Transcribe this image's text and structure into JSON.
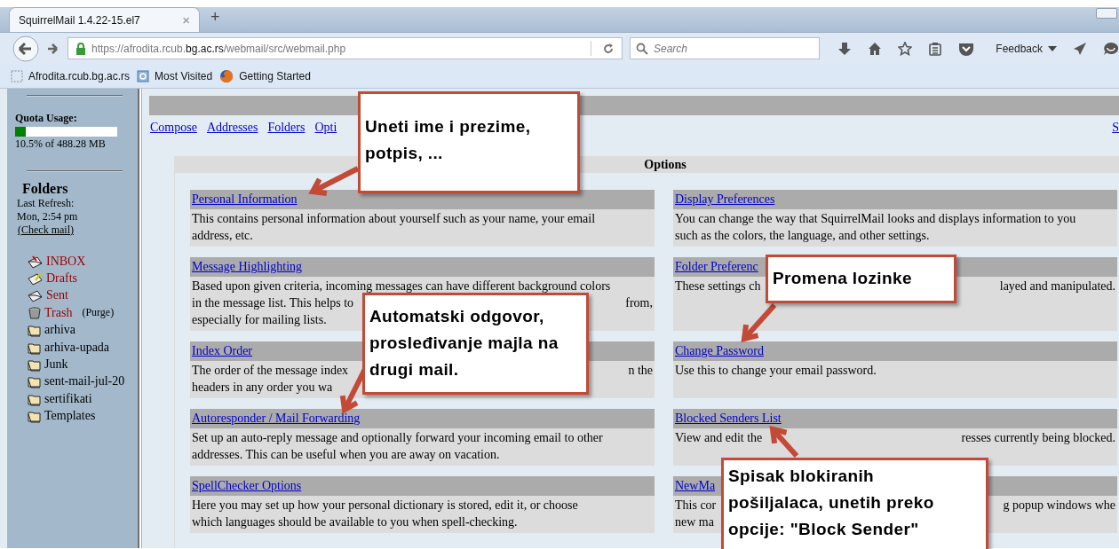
{
  "browser": {
    "tab_title": "SquirrelMail 1.4.22-15.el7",
    "tab_close": "×",
    "new_tab": "+",
    "url": {
      "start": "https://afrodita.rcub.",
      "domain": "bg.ac.rs",
      "path": "/webmail/src/webmail.php"
    },
    "search_placeholder": "Search",
    "feedback": "Feedback",
    "bookmarks": [
      "Afrodita.rcub.bg.ac.rs",
      "Most Visited",
      "Getting Started"
    ]
  },
  "sidebar": {
    "quota": {
      "label": "Quota Usage:",
      "level": 0.105,
      "reading": "10.5% of 488.28 MB"
    },
    "folders_title": "Folders",
    "last_refresh_label": "Last Refresh:",
    "last_refresh": "Mon, 2:54 pm",
    "check_mail": "(Check mail)",
    "folders": [
      {
        "name": "INBOX",
        "kind": "inbox"
      },
      {
        "name": "Drafts",
        "kind": "drafts"
      },
      {
        "name": "Sent",
        "kind": "sent"
      },
      {
        "name": "Trash",
        "kind": "trash",
        "action": "(Purge)"
      },
      {
        "name": "arhiva",
        "kind": "folder"
      },
      {
        "name": "arhiva-upada",
        "kind": "folder"
      },
      {
        "name": "Junk",
        "kind": "folder"
      },
      {
        "name": "sent-mail-jul-20",
        "kind": "folder"
      },
      {
        "name": "sertifikati",
        "kind": "folder"
      },
      {
        "name": "Templates",
        "kind": "folder"
      }
    ]
  },
  "nav_links": [
    "Compose",
    "Addresses",
    "Folders",
    "Opti"
  ],
  "nav_right": "S",
  "options": {
    "title": "Options",
    "left": [
      {
        "title": "Personal Information",
        "lines": [
          [
            "This contains personal information about yourself such as your name, your email"
          ],
          [
            "address, etc."
          ]
        ]
      },
      {
        "title": "Message Highlighting",
        "lines": [
          [
            "Based upon given criteria, incoming messages can have different background colors"
          ],
          [
            "in the message list. This helps to",
            "from,"
          ],
          [
            "especially for mailing lists."
          ]
        ]
      },
      {
        "title": "Index Order",
        "lines": [
          [
            "The order of the message index",
            "n the"
          ],
          [
            "headers in any order you wa"
          ]
        ]
      },
      {
        "title": "Autoresponder / Mail Forwarding",
        "lines": [
          [
            "Set up an auto-reply message and optionally forward your incoming email to other"
          ],
          [
            "addresses. This can be useful when you are away on vacation."
          ]
        ]
      },
      {
        "title": "SpellChecker Options",
        "lines": [
          [
            "Here you may set up how your personal dictionary is stored, edit it, or choose"
          ],
          [
            "which languages should be available to you when spell-checking."
          ]
        ]
      }
    ],
    "right": [
      {
        "title": "Display Preferences",
        "lines": [
          [
            "You can change the way that SquirrelMail looks and displays information to you"
          ],
          [
            "such as the colors, the language, and other settings."
          ]
        ]
      },
      {
        "title": "Folder Preferenc",
        "lines": [
          [
            "These settings ch",
            "layed and manipulated."
          ]
        ]
      },
      {
        "title": "Change Password",
        "lines": [
          [
            "Use this to change your email password."
          ]
        ]
      },
      {
        "title": "Blocked Senders List",
        "lines": [
          [
            "View and edit the",
            "resses currently being blocked."
          ]
        ]
      },
      {
        "title": "NewMa",
        "lines": [
          [
            "This cor",
            "g popup windows whe"
          ],
          [
            "new ma"
          ]
        ]
      }
    ]
  },
  "callouts": [
    {
      "text": "Uneti ime i prezime, potpis, ..."
    },
    {
      "text": "Automatski odgovor, prosleđivanje majla na drugi mail."
    },
    {
      "text": "Promena lozinke"
    },
    {
      "text": "Spisak blokiranih pošiljalaca, unetih preko opcije: \"Block Sender\""
    }
  ]
}
